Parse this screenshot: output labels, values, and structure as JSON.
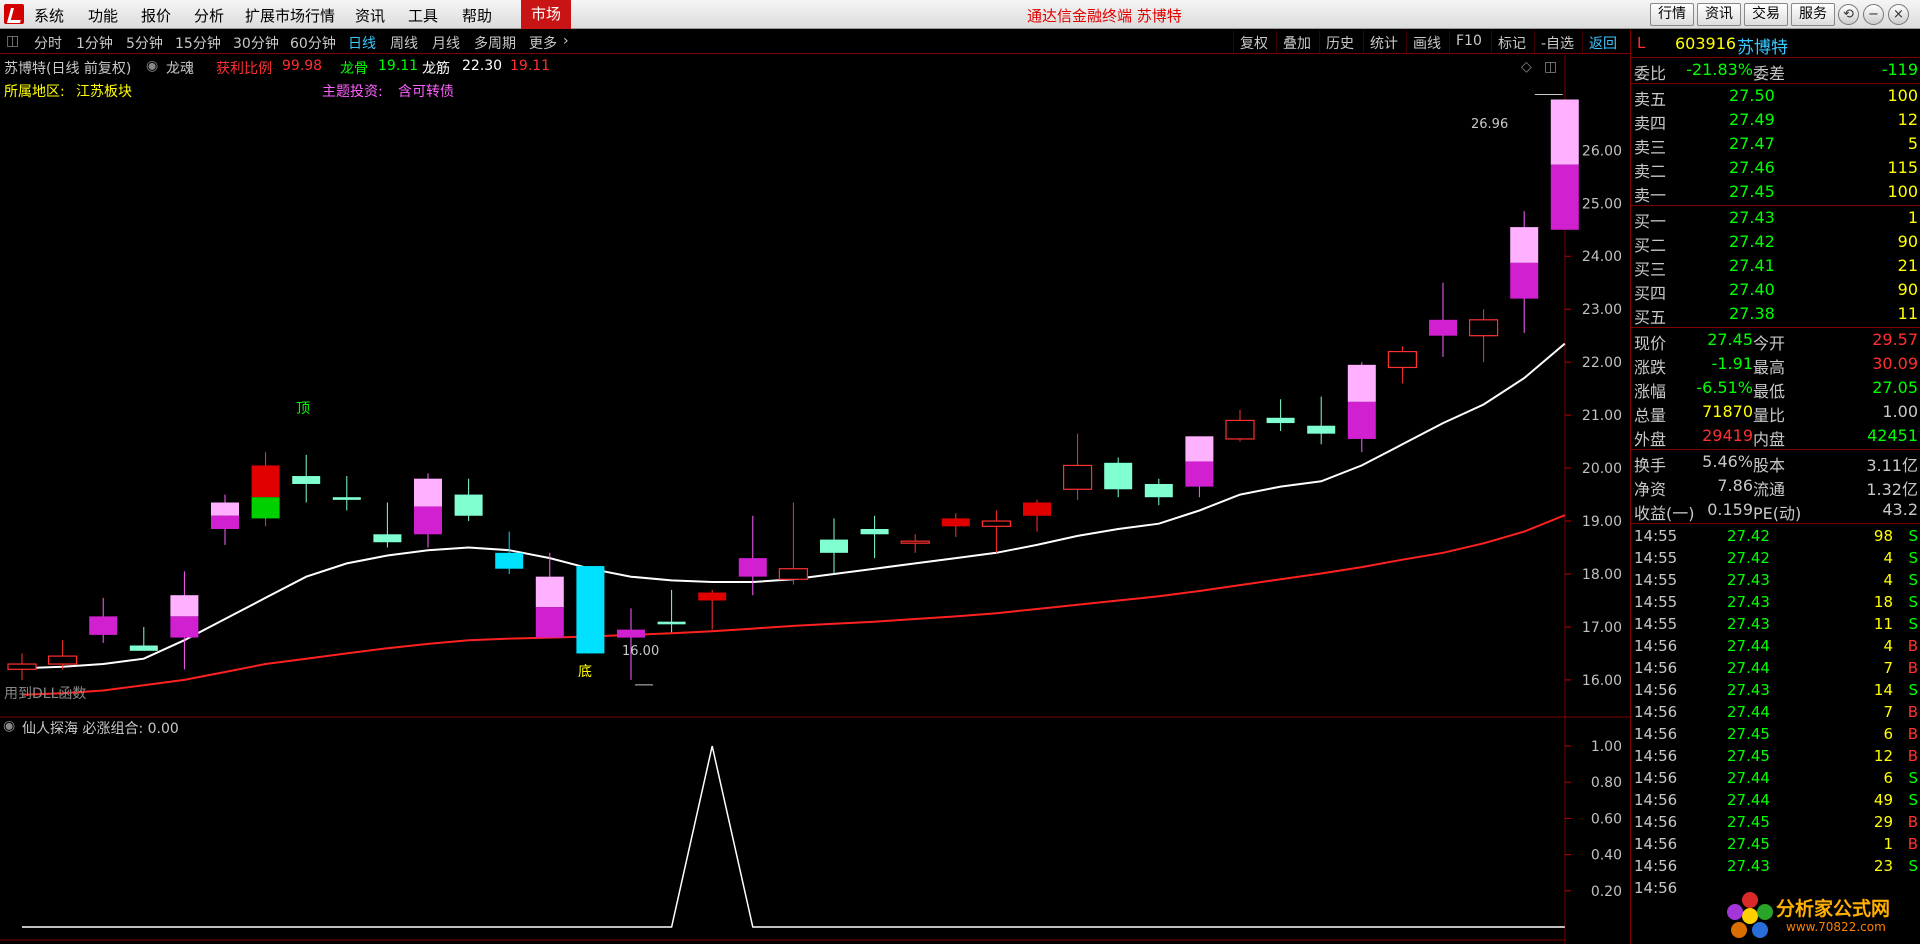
{
  "menu": {
    "items": [
      "系统",
      "功能",
      "报价",
      "分析",
      "扩展市场行情",
      "资讯",
      "工具",
      "帮助"
    ],
    "market": "市场",
    "title": "通达信金融终端  苏博特",
    "right_buttons": [
      "行情",
      "资讯",
      "交易",
      "服务"
    ]
  },
  "periods": {
    "items": [
      "分时",
      "1分钟",
      "5分钟",
      "15分钟",
      "30分钟",
      "60分钟",
      "日线",
      "周线",
      "月线",
      "多周期",
      "更多"
    ],
    "active": "日线"
  },
  "tools": [
    "复权",
    "叠加",
    "历史",
    "统计",
    "画线",
    "F10",
    "标记",
    "-自选",
    "返回"
  ],
  "chart_info": {
    "name": "苏博特(日线 前复权)",
    "indicator": "龙魂",
    "profit_label": "获利比例",
    "profit_value": "99.98",
    "bone_label": "龙骨",
    "bone_value": "19.11",
    "tendon_label": "龙筋",
    "tendon_value1": "22.30",
    "tendon_value2": "19.11",
    "region_label": "所属地区:",
    "region_value": "江苏板块",
    "theme_label": "主题投资:",
    "theme_value": "含可转债",
    "dll_text": "用到DLL函数",
    "top_label": "顶",
    "bottom_label": "底",
    "high_price": "26.96",
    "low_price": "16.00"
  },
  "sub_chart": {
    "title": "仙人探海  必涨组合: 0.00"
  },
  "colors": {
    "up": "#ff00ff",
    "down": "#00ffff",
    "bg": "#000000",
    "grid": "#800000",
    "ma_white": "#ffffff",
    "ma_red": "#ff2020",
    "accent": "#c81414"
  },
  "chart_data": {
    "type": "candlestick",
    "y_ticks": [
      16.0,
      17.0,
      18.0,
      19.0,
      20.0,
      21.0,
      22.0,
      23.0,
      24.0,
      25.0,
      26.0
    ],
    "y_range": [
      15.3,
      27.8
    ],
    "sub_y_ticks": [
      0.2,
      0.4,
      0.6,
      0.8,
      1.0
    ],
    "sub_y_range": [
      0,
      1.05
    ],
    "candles": [
      {
        "o": 16.3,
        "c": 16.2,
        "h": 16.5,
        "l": 16.0,
        "col": "ro"
      },
      {
        "o": 16.3,
        "c": 16.45,
        "h": 16.75,
        "l": 16.2,
        "col": "ro"
      },
      {
        "o": 16.85,
        "c": 17.2,
        "h": 17.55,
        "l": 16.7,
        "col": "mg"
      },
      {
        "o": 16.65,
        "c": 16.55,
        "h": 17.0,
        "l": 16.55,
        "col": "cy"
      },
      {
        "o": 16.8,
        "c": 17.6,
        "h": 18.05,
        "l": 16.2,
        "col": "mp"
      },
      {
        "o": 18.85,
        "c": 19.35,
        "h": 19.5,
        "l": 18.55,
        "col": "mp"
      },
      {
        "o": 19.05,
        "c": 20.05,
        "h": 20.3,
        "l": 18.9,
        "col": "rg"
      },
      {
        "o": 19.85,
        "c": 19.7,
        "h": 20.25,
        "l": 19.35,
        "col": "cy"
      },
      {
        "o": 19.45,
        "c": 19.4,
        "h": 19.85,
        "l": 19.2,
        "col": "cy"
      },
      {
        "o": 18.6,
        "c": 18.75,
        "h": 19.35,
        "l": 18.5,
        "col": "cy"
      },
      {
        "o": 18.75,
        "c": 19.8,
        "h": 19.9,
        "l": 18.5,
        "col": "mp"
      },
      {
        "o": 19.5,
        "c": 19.1,
        "h": 19.8,
        "l": 19.0,
        "col": "cy"
      },
      {
        "o": 18.4,
        "c": 18.1,
        "h": 18.8,
        "l": 18.0,
        "col": "bl"
      },
      {
        "o": 16.8,
        "c": 17.95,
        "h": 18.4,
        "l": 16.8,
        "col": "mp"
      },
      {
        "o": 18.15,
        "c": 16.5,
        "h": 18.15,
        "l": 16.5,
        "col": "bl"
      },
      {
        "o": 16.8,
        "c": 16.95,
        "h": 17.35,
        "l": 16.0,
        "col": "mg"
      },
      {
        "o": 17.1,
        "c": 17.05,
        "h": 17.7,
        "l": 16.9,
        "col": "cy"
      },
      {
        "o": 17.65,
        "c": 17.5,
        "h": 17.7,
        "l": 16.95,
        "col": "rd"
      },
      {
        "o": 17.95,
        "c": 18.3,
        "h": 19.1,
        "l": 17.6,
        "col": "mg"
      },
      {
        "o": 17.9,
        "c": 18.1,
        "h": 19.35,
        "l": 17.8,
        "col": "ro"
      },
      {
        "o": 18.65,
        "c": 18.4,
        "h": 19.05,
        "l": 18.0,
        "col": "cy"
      },
      {
        "o": 18.85,
        "c": 18.75,
        "h": 19.1,
        "l": 18.3,
        "col": "cy"
      },
      {
        "o": 18.6,
        "c": 18.62,
        "h": 18.75,
        "l": 18.4,
        "col": "ro"
      },
      {
        "o": 18.9,
        "c": 19.05,
        "h": 19.15,
        "l": 18.7,
        "col": "rd"
      },
      {
        "o": 18.9,
        "c": 19.0,
        "h": 19.2,
        "l": 18.4,
        "col": "ro"
      },
      {
        "o": 19.1,
        "c": 19.35,
        "h": 19.4,
        "l": 18.8,
        "col": "rd"
      },
      {
        "o": 19.6,
        "c": 20.05,
        "h": 20.65,
        "l": 19.4,
        "col": "ro"
      },
      {
        "o": 20.1,
        "c": 19.6,
        "h": 20.2,
        "l": 19.45,
        "col": "cy"
      },
      {
        "o": 19.7,
        "c": 19.45,
        "h": 19.8,
        "l": 19.3,
        "col": "cy"
      },
      {
        "o": 19.65,
        "c": 20.6,
        "h": 20.6,
        "l": 19.45,
        "col": "mp"
      },
      {
        "o": 20.55,
        "c": 20.9,
        "h": 21.1,
        "l": 20.5,
        "col": "ro"
      },
      {
        "o": 20.95,
        "c": 20.85,
        "h": 21.3,
        "l": 20.7,
        "col": "cy"
      },
      {
        "o": 20.8,
        "c": 20.65,
        "h": 21.35,
        "l": 20.45,
        "col": "cy"
      },
      {
        "o": 20.55,
        "c": 21.95,
        "h": 22.0,
        "l": 20.3,
        "col": "mp"
      },
      {
        "o": 21.9,
        "c": 22.2,
        "h": 22.3,
        "l": 21.6,
        "col": "ro"
      },
      {
        "o": 22.5,
        "c": 22.8,
        "h": 23.5,
        "l": 22.1,
        "col": "mg"
      },
      {
        "o": 22.5,
        "c": 22.8,
        "h": 23.0,
        "l": 22.0,
        "col": "ro"
      },
      {
        "o": 23.2,
        "c": 24.55,
        "h": 24.85,
        "l": 22.55,
        "col": "mp"
      },
      {
        "o": 24.5,
        "c": 26.96,
        "h": 26.96,
        "l": 24.5,
        "col": "mp"
      }
    ],
    "ma_white": [
      16.22,
      16.25,
      16.3,
      16.4,
      16.75,
      17.15,
      17.55,
      17.95,
      18.2,
      18.35,
      18.45,
      18.5,
      18.45,
      18.3,
      18.1,
      17.95,
      17.88,
      17.85,
      17.85,
      17.9,
      18.0,
      18.1,
      18.2,
      18.3,
      18.4,
      18.55,
      18.72,
      18.85,
      18.95,
      19.2,
      19.5,
      19.65,
      19.75,
      20.05,
      20.45,
      20.85,
      21.2,
      21.7,
      22.35
    ],
    "ma_red": [
      15.72,
      15.75,
      15.8,
      15.9,
      16.0,
      16.15,
      16.3,
      16.4,
      16.5,
      16.6,
      16.68,
      16.75,
      16.78,
      16.8,
      16.82,
      16.85,
      16.88,
      16.92,
      16.97,
      17.02,
      17.06,
      17.1,
      17.15,
      17.2,
      17.26,
      17.34,
      17.42,
      17.5,
      17.58,
      17.68,
      17.79,
      17.9,
      18.01,
      18.13,
      18.27,
      18.4,
      18.58,
      18.8,
      19.11
    ],
    "signal": [
      0,
      0,
      0,
      0,
      0,
      0,
      0,
      0,
      0,
      0,
      0,
      0,
      0,
      0,
      0,
      0,
      0,
      1.0,
      0,
      0,
      0,
      0,
      0,
      0,
      0,
      0,
      0,
      0,
      0,
      0,
      0,
      0,
      0,
      0,
      0,
      0,
      0,
      0,
      0
    ]
  },
  "quote": {
    "flag": "L",
    "code": "603916",
    "name": "苏博特",
    "wei_bi_label": "委比",
    "wei_bi": "-21.83%",
    "wei_cha_label": "委差",
    "wei_cha": "-119",
    "asks": [
      {
        "label": "卖五",
        "price": "27.50",
        "vol": "100"
      },
      {
        "label": "卖四",
        "price": "27.49",
        "vol": "12"
      },
      {
        "label": "卖三",
        "price": "27.47",
        "vol": "5"
      },
      {
        "label": "卖二",
        "price": "27.46",
        "vol": "115"
      },
      {
        "label": "卖一",
        "price": "27.45",
        "vol": "100"
      }
    ],
    "bids": [
      {
        "label": "买一",
        "price": "27.43",
        "vol": "1"
      },
      {
        "label": "买二",
        "price": "27.42",
        "vol": "90"
      },
      {
        "label": "买三",
        "price": "27.41",
        "vol": "21"
      },
      {
        "label": "买四",
        "price": "27.40",
        "vol": "90"
      },
      {
        "label": "买五",
        "price": "27.38",
        "vol": "11"
      }
    ],
    "stats1": [
      {
        "l1": "现价",
        "v1": "27.45",
        "c1": "#00ff00",
        "l2": "今开",
        "v2": "29.57",
        "c2": "#ff3030"
      },
      {
        "l1": "涨跌",
        "v1": "-1.91",
        "c1": "#00ff00",
        "l2": "最高",
        "v2": "30.09",
        "c2": "#ff3030"
      },
      {
        "l1": "涨幅",
        "v1": "-6.51%",
        "c1": "#00ff00",
        "l2": "最低",
        "v2": "27.05",
        "c2": "#00ff00"
      },
      {
        "l1": "总量",
        "v1": "71870",
        "c1": "#ffff00",
        "l2": "量比",
        "v2": "1.00",
        "c2": "#c8c8c8"
      },
      {
        "l1": "外盘",
        "v1": "29419",
        "c1": "#ff3030",
        "l2": "内盘",
        "v2": "42451",
        "c2": "#00ff00"
      }
    ],
    "stats2": [
      {
        "l1": "换手",
        "v1": "5.46%",
        "c1": "#c8c8c8",
        "l2": "股本",
        "v2": "3.11亿",
        "c2": "#c8c8c8"
      },
      {
        "l1": "净资",
        "v1": "7.86",
        "c1": "#c8c8c8",
        "l2": "流通",
        "v2": "1.32亿",
        "c2": "#c8c8c8"
      },
      {
        "l1": "收益(一)",
        "v1": "0.159",
        "c1": "#c8c8c8",
        "l2": "PE(动)",
        "v2": "43.2",
        "c2": "#c8c8c8"
      }
    ],
    "ticks": [
      {
        "t": "14:55",
        "p": "27.42",
        "v": "98",
        "s": "S"
      },
      {
        "t": "14:55",
        "p": "27.42",
        "v": "4",
        "s": "S"
      },
      {
        "t": "14:55",
        "p": "27.43",
        "v": "4",
        "s": "S"
      },
      {
        "t": "14:55",
        "p": "27.43",
        "v": "18",
        "s": "S"
      },
      {
        "t": "14:55",
        "p": "27.43",
        "v": "11",
        "s": "S"
      },
      {
        "t": "14:56",
        "p": "27.44",
        "v": "4",
        "s": "B"
      },
      {
        "t": "14:56",
        "p": "27.44",
        "v": "7",
        "s": "B"
      },
      {
        "t": "14:56",
        "p": "27.43",
        "v": "14",
        "s": "S"
      },
      {
        "t": "14:56",
        "p": "27.44",
        "v": "7",
        "s": "B"
      },
      {
        "t": "14:56",
        "p": "27.45",
        "v": "6",
        "s": "B"
      },
      {
        "t": "14:56",
        "p": "27.45",
        "v": "12",
        "s": "B"
      },
      {
        "t": "14:56",
        "p": "27.44",
        "v": "6",
        "s": "S"
      },
      {
        "t": "14:56",
        "p": "27.44",
        "v": "49",
        "s": "S"
      },
      {
        "t": "14:56",
        "p": "27.45",
        "v": "29",
        "s": "B"
      },
      {
        "t": "14:56",
        "p": "27.45",
        "v": "1",
        "s": "B"
      },
      {
        "t": "14:56",
        "p": "27.43",
        "v": "23",
        "s": "S"
      },
      {
        "t": "14:56",
        "p": "",
        "v": "",
        "s": ""
      }
    ]
  },
  "watermark": {
    "text": "分析家公式网",
    "url": "www.70822.com"
  }
}
